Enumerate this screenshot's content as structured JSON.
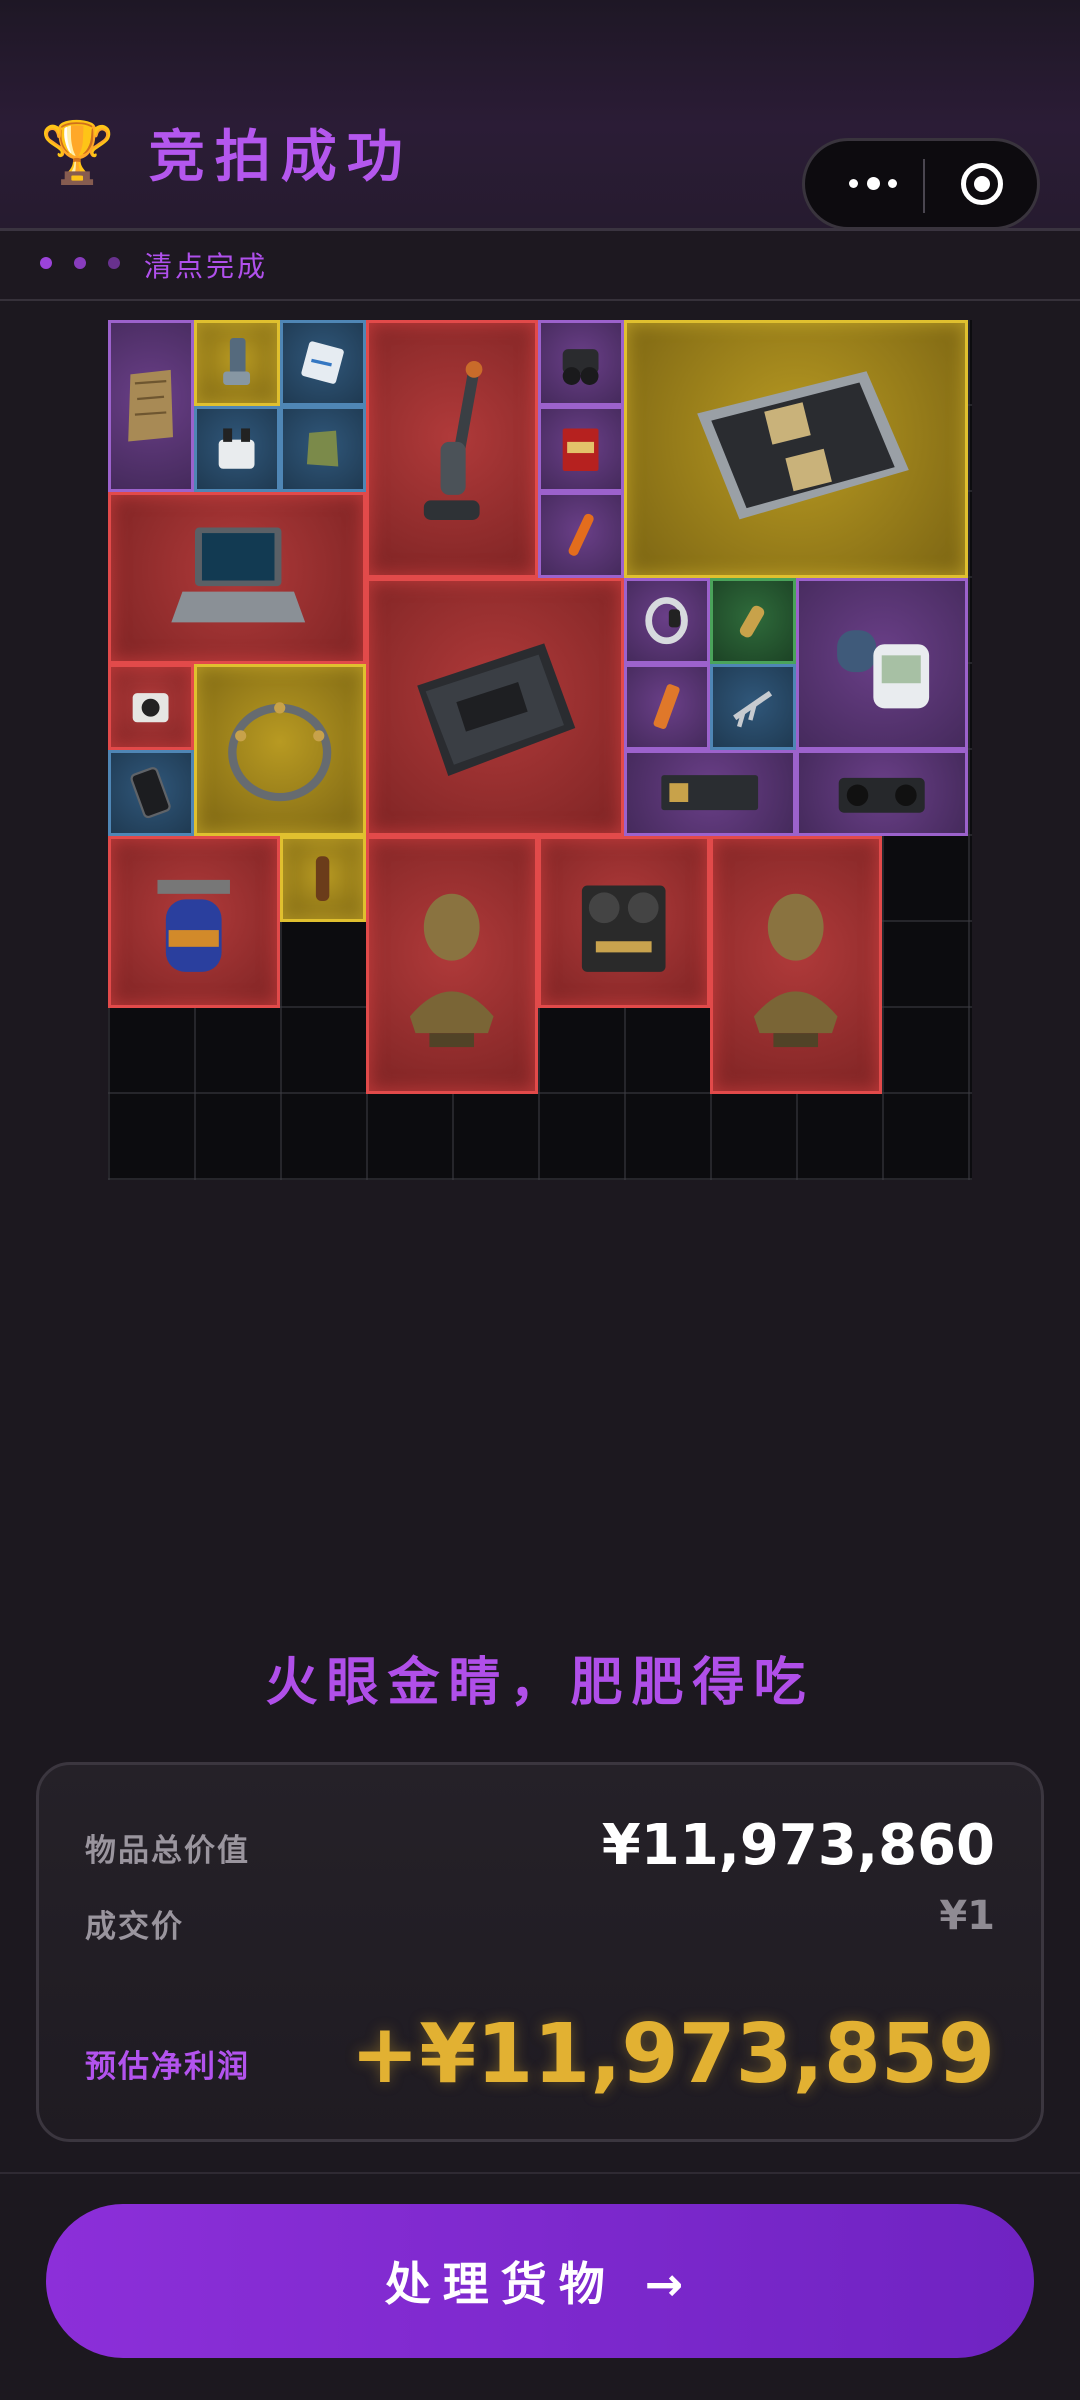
{
  "header": {
    "icon": "trophy-icon",
    "title": "竞拍成功"
  },
  "substatus": {
    "label": "清点完成"
  },
  "inventory": {
    "items": [
      {
        "name": "old-map",
        "rarity": "purple"
      },
      {
        "name": "inhaler",
        "rarity": "gold"
      },
      {
        "name": "pill-box",
        "rarity": "blue"
      },
      {
        "name": "cooling-pot",
        "rarity": "blue"
      },
      {
        "name": "snack-bag",
        "rarity": "blue"
      },
      {
        "name": "cordless-vacuum",
        "rarity": "red"
      },
      {
        "name": "night-vision-goggles",
        "rarity": "purple"
      },
      {
        "name": "cigarette-box",
        "rarity": "purple"
      },
      {
        "name": "flare",
        "rarity": "purple"
      },
      {
        "name": "server-motherboard",
        "rarity": "gold"
      },
      {
        "name": "rugged-laptop",
        "rarity": "red"
      },
      {
        "name": "equipment-case",
        "rarity": "red"
      },
      {
        "name": "smart-band",
        "rarity": "purple"
      },
      {
        "name": "bullet",
        "rarity": "green"
      },
      {
        "name": "blood-pressure-monitor",
        "rarity": "purple"
      },
      {
        "name": "action-camera",
        "rarity": "red"
      },
      {
        "name": "neural-headset",
        "rarity": "gold"
      },
      {
        "name": "energy-bar",
        "rarity": "purple"
      },
      {
        "name": "caliper",
        "rarity": "blue"
      },
      {
        "name": "graphics-card",
        "rarity": "purple"
      },
      {
        "name": "boombox",
        "rarity": "purple"
      },
      {
        "name": "phone",
        "rarity": "blue"
      },
      {
        "name": "gas-canister",
        "rarity": "red"
      },
      {
        "name": "drink-bottle",
        "rarity": "gold"
      },
      {
        "name": "bronze-bust",
        "rarity": "red"
      },
      {
        "name": "reel-tape-recorder",
        "rarity": "red"
      },
      {
        "name": "bronze-bust-2",
        "rarity": "red"
      }
    ]
  },
  "slogan": "火眼金睛，肥肥得吃",
  "summary": {
    "total_label": "物品总价值",
    "total_value": "¥11,973,860",
    "deal_label": "成交价",
    "deal_value": "¥1",
    "profit_label": "预估净利润",
    "profit_value": "+¥11,973,859"
  },
  "cta": {
    "label": "处理货物 →"
  },
  "colors": {
    "accent": "#b457ee",
    "gold": "#e2b132",
    "cta_start": "#8c2fd9",
    "cta_end": "#6f23c2"
  }
}
